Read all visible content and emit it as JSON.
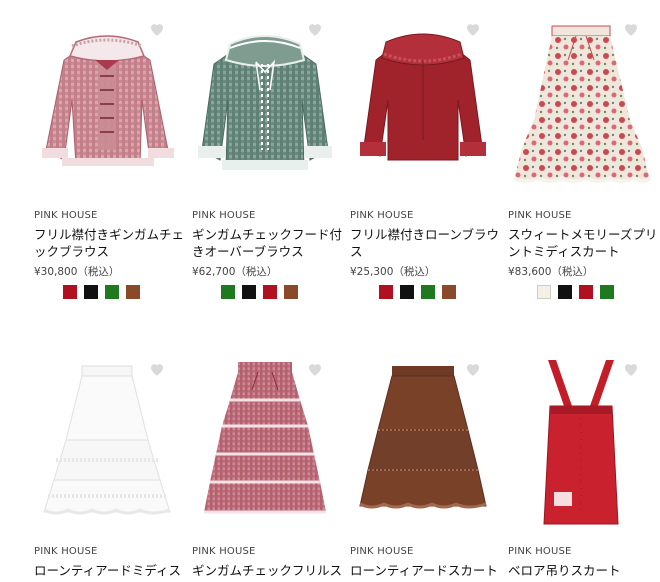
{
  "products": [
    {
      "brand": "PINK HOUSE",
      "title": "フリル襟付きギンガムチェックブラウス",
      "price": "¥30,800（税込）",
      "image": "red-gingham-blouse",
      "swatches": [
        "#b01020",
        "#111111",
        "#1f7a1f",
        "#8a4a2a"
      ]
    },
    {
      "brand": "PINK HOUSE",
      "title": "ギンガムチェックフード付きオーバーブラウス",
      "price": "¥62,700（税込）",
      "image": "green-gingham-blouse",
      "swatches": [
        "#1f7a1f",
        "#111111",
        "#b01020",
        "#8a4a2a"
      ]
    },
    {
      "brand": "PINK HOUSE",
      "title": "フリル襟付きローンブラウス",
      "price": "¥25,300（税込）",
      "image": "red-lawn-blouse",
      "swatches": [
        "#b01020",
        "#111111",
        "#1f7a1f",
        "#8a4a2a"
      ]
    },
    {
      "brand": "PINK HOUSE",
      "title": "スウィートメモリーズプリントミディスカート",
      "price": "¥83,600（税込）",
      "image": "floral-print-skirt",
      "swatches": [
        "#f4f0e4",
        "#111111",
        "#b01020",
        "#1f7a1f"
      ]
    },
    {
      "brand": "PINK HOUSE",
      "title": "ローンティアードミディス",
      "price": "",
      "image": "white-tiered-skirt",
      "swatches": []
    },
    {
      "brand": "PINK HOUSE",
      "title": "ギンガムチェックフリルス",
      "price": "",
      "image": "pink-frill-skirt",
      "swatches": []
    },
    {
      "brand": "PINK HOUSE",
      "title": "ローンティアードスカート",
      "price": "",
      "image": "brown-tiered-skirt",
      "swatches": []
    },
    {
      "brand": "PINK HOUSE",
      "title": "ベロア吊りスカート",
      "price": "",
      "image": "red-suspender-skirt",
      "swatches": []
    }
  ],
  "icons": {
    "favorite": "heart-icon"
  },
  "colors": {
    "heart": "#d9d9d9"
  }
}
